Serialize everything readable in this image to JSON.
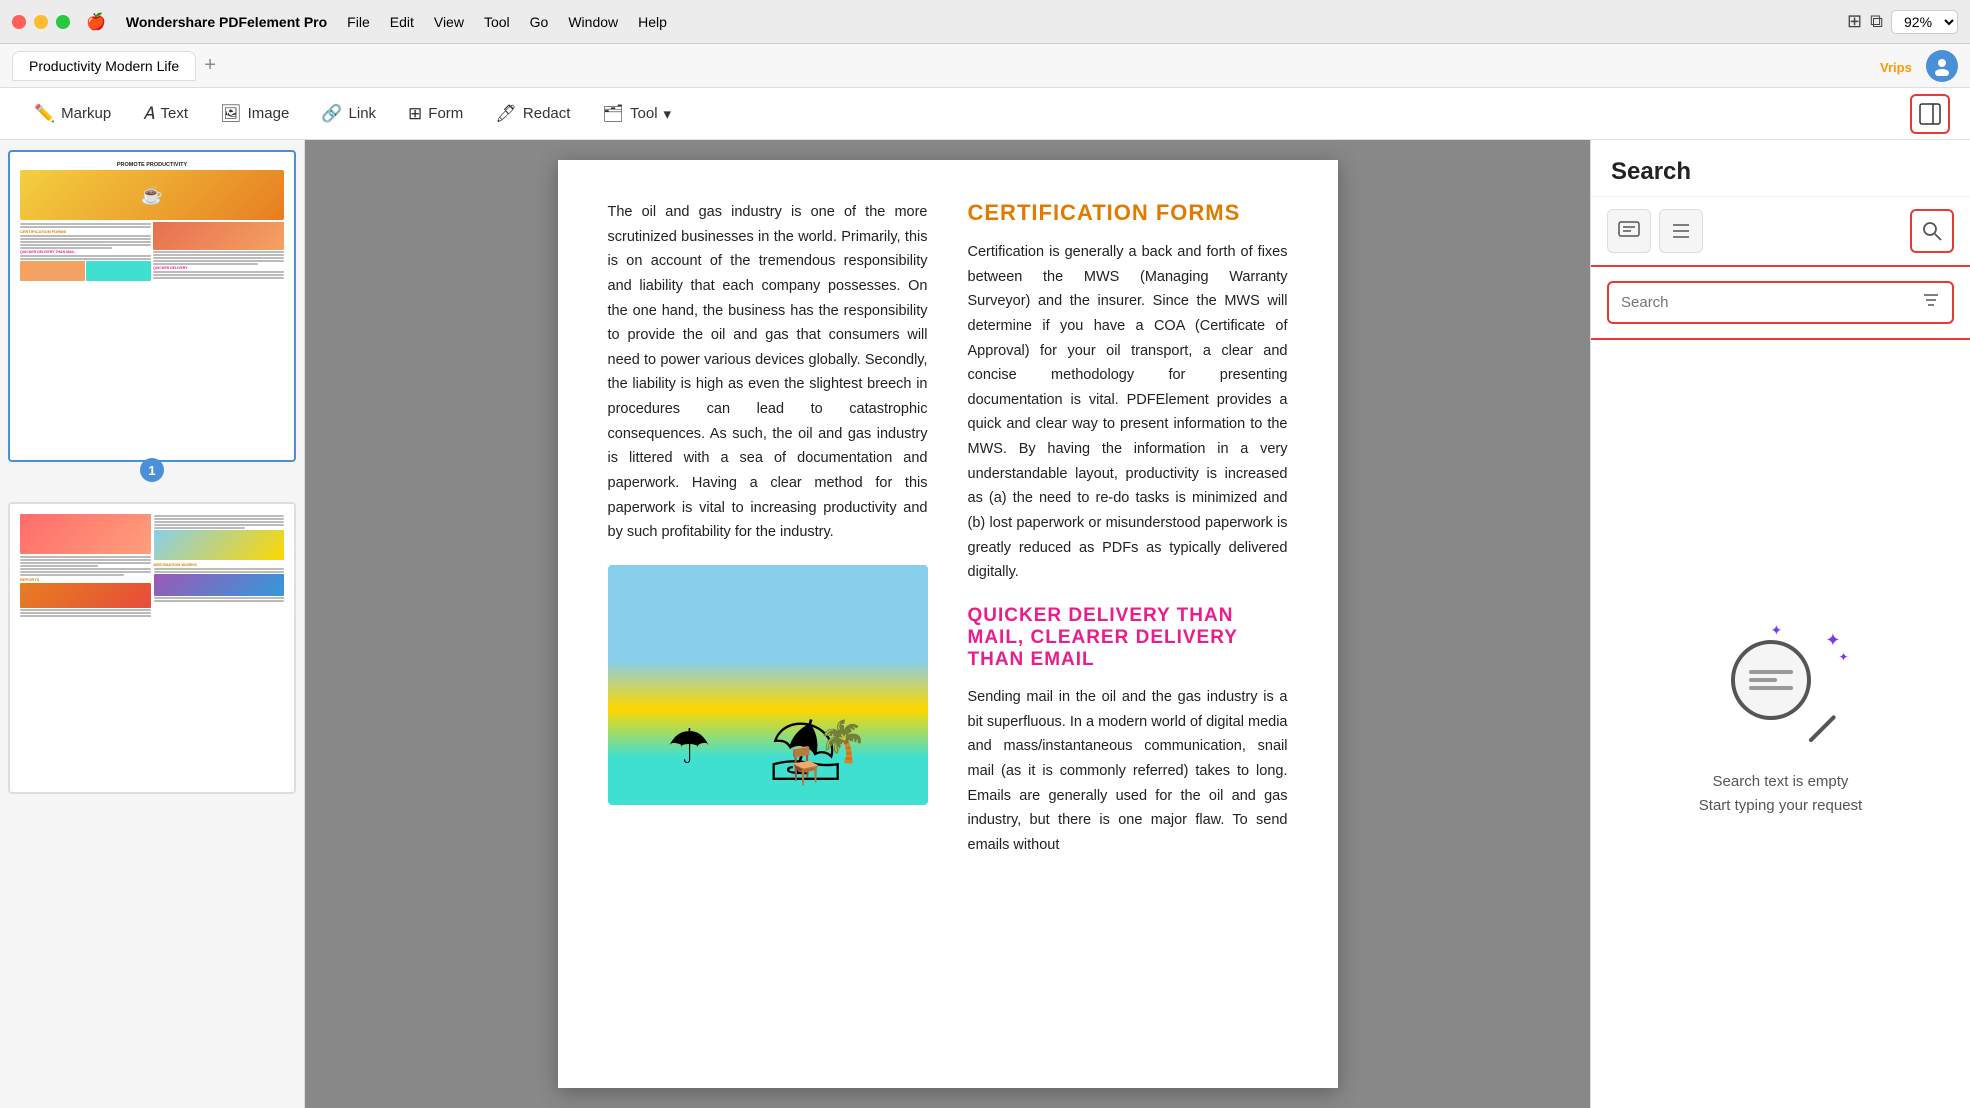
{
  "app": {
    "name": "Wondershare PDFelement Pro",
    "menus": [
      "File",
      "Edit",
      "View",
      "Tool",
      "Go",
      "Window",
      "Help"
    ]
  },
  "traffic_lights": {
    "red_label": "close",
    "yellow_label": "minimize",
    "green_label": "maximize"
  },
  "zoom": "92%",
  "tab": {
    "title": "Productivity Modern Life",
    "add_label": "+"
  },
  "toolbar": {
    "markup_label": "Markup",
    "text_label": "Text",
    "image_label": "Image",
    "link_label": "Link",
    "form_label": "Form",
    "redact_label": "Redact",
    "tool_label": "Tool"
  },
  "sidebar": {
    "page1_num": "1"
  },
  "pdf_content": {
    "body_para1": "The oil and gas industry is one of the more scrutinized businesses in the world. Primarily, this is on account of the tremendous responsibility and liability that each company possesses. On the one hand, the business has the responsibility to provide the oil and gas that consumers will need to power various devices globally. Secondly, the liability is high as even the slightest breech in procedures can lead to catastrophic consequences. As such, the oil and gas industry is littered with a sea of documentation and paperwork. Having a clear method for this paperwork is vital to increasing productivity and by such profitability for the industry.",
    "cert_heading": "CERTIFICATION FORMS",
    "cert_para": "Certification is generally a back and forth of fixes between the MWS (Managing Warranty Surveyor) and the insurer. Since the MWS will determine if you have a COA (Certificate of Approval) for your oil transport, a clear and concise methodology for presenting documentation is vital. PDFElement provides a quick and clear way to present information to the MWS. By having the information in a very understandable layout, productivity is increased as (a) the need to re-do tasks is minimized and (b) lost paperwork or misunderstood paperwork is greatly reduced as PDFs as typically delivered digitally.",
    "quicker_heading": "QUICKER DELIVERY THAN MAIL, CLEARER DELIVERY THAN EMAIL",
    "quicker_para": "Sending mail in the oil and the gas industry is a bit superfluous. In a modern world of digital media and mass/instantaneous communication, snail mail (as it is commonly referred) takes to long. Emails are generally used for the oil and gas industry, but there is one major flaw. To send emails without"
  },
  "right_panel": {
    "title": "Search",
    "search_placeholder": "Search",
    "empty_line1": "Search text is empty",
    "empty_line2": "Start typing your request",
    "tab_comment_icon": "💬",
    "tab_list_icon": "☰",
    "tab_search_icon": "🔍"
  }
}
